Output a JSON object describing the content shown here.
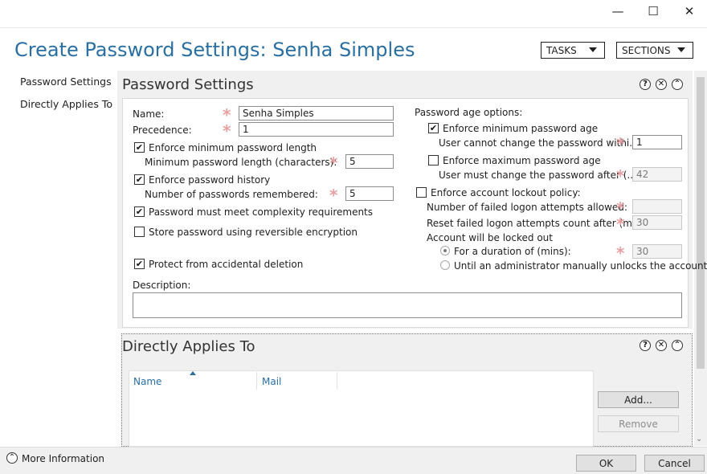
{
  "window": {
    "title": "Create Password Settings: Senha Simples",
    "controls": {
      "minimize": "—",
      "maximize": "☐",
      "close": "✕"
    }
  },
  "header": {
    "tasks_label": "TASKS",
    "sections_label": "SECTIONS"
  },
  "leftnav": {
    "items": [
      {
        "label": "Password Settings"
      },
      {
        "label": "Directly Applies To"
      }
    ]
  },
  "password_settings": {
    "section_title": "Password Settings",
    "name_label": "Name:",
    "name_value": "Senha Simples",
    "precedence_label": "Precedence:",
    "precedence_value": "1",
    "enforce_min_length": {
      "label": "Enforce minimum password length",
      "checked": true
    },
    "min_length_label": "Minimum password length (characters):",
    "min_length_value": "5",
    "enforce_history": {
      "label": "Enforce password history",
      "checked": true
    },
    "history_label": "Number of passwords remembered:",
    "history_value": "5",
    "complexity": {
      "label": "Password must meet complexity requirements",
      "checked": true
    },
    "reversible": {
      "label": "Store password using reversible encryption",
      "checked": false
    },
    "protect": {
      "label": "Protect from accidental deletion",
      "checked": true
    },
    "description_label": "Description:",
    "description_value": "",
    "age_options_label": "Password age options:",
    "enforce_min_age": {
      "label": "Enforce minimum password age",
      "checked": true
    },
    "min_age_label": "User cannot change the password withi...",
    "min_age_value": "1",
    "enforce_max_age": {
      "label": "Enforce maximum password age",
      "checked": false
    },
    "max_age_label": "User must change the password after (...",
    "max_age_value": "42",
    "lockout": {
      "label": "Enforce account lockout policy:",
      "checked": false
    },
    "failed_attempts_label": "Number of failed logon attempts allowed:",
    "failed_attempts_value": "",
    "reset_count_label": "Reset failed logon attempts count after (m...",
    "reset_count_value": "30",
    "locked_out_label": "Account will be locked out",
    "duration_label": "For a duration of (mins):",
    "duration_value": "30",
    "manual_unlock_label": "Until an administrator manually unlocks the account"
  },
  "applies_to": {
    "section_title": "Directly Applies To",
    "columns": [
      "Name",
      "Mail"
    ],
    "add_label": "Add...",
    "remove_label": "Remove"
  },
  "footer": {
    "more_info_label": "More Information",
    "ok_label": "OK",
    "cancel_label": "Cancel"
  },
  "colors": {
    "accent": "#2a6fa1",
    "required_star": "#e8a0a0",
    "panel_bg": "#f0f0f0"
  }
}
